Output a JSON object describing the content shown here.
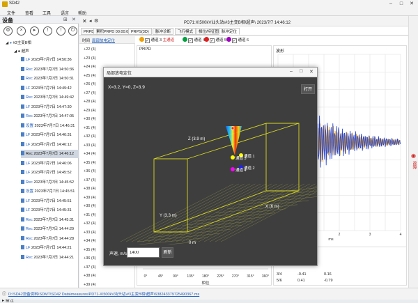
{
  "app": {
    "title": "SD42"
  },
  "menu": [
    "文件",
    "查看",
    "工具",
    "语言",
    "帮助"
  ],
  "left_panel": {
    "title": "设备",
    "tree_root": "#3主变B相",
    "tree_group": "超声",
    "records": [
      {
        "type": "LF",
        "date": "2023年7月7日 14:50:36"
      },
      {
        "type": "Rec",
        "date": "2023年7月7日 14:50:36"
      },
      {
        "type": "Rec",
        "date": "2023年7月7日 14:50:31"
      },
      {
        "type": "LF",
        "date": "2023年7月7日 14:49:42"
      },
      {
        "type": "Rec",
        "date": "2023年7月7日 14:49:42"
      },
      {
        "type": "LF",
        "date": "2023年7月7日 14:47:30"
      },
      {
        "type": "Rec",
        "date": "2023年7月7日 14:47:05"
      },
      {
        "type": "设置",
        "date": "2023年7月7日 14:46:31"
      },
      {
        "type": "LF",
        "date": "2023年7月7日 14:46:31"
      },
      {
        "type": "LF",
        "date": "2023年7月7日 14:46:12"
      },
      {
        "type": "Rec",
        "date": "2023年7月7日 14:46:12"
      },
      {
        "type": "LF",
        "date": "2023年7月7日 14:46:06"
      },
      {
        "type": "LF",
        "date": "2023年7月7日 14:45:52"
      },
      {
        "type": "Rec",
        "date": "2023年7月7日 14:45:52"
      },
      {
        "type": "设置",
        "date": "2023年7月7日 14:45:51"
      },
      {
        "type": "LF",
        "date": "2023年7月7日 14:45:51"
      },
      {
        "type": "LF",
        "date": "2023年7月7日 14:45:31"
      },
      {
        "type": "Rec",
        "date": "2023年7月7日 14:45:31"
      },
      {
        "type": "Rec",
        "date": "2023年7月7日 14:44:29"
      },
      {
        "type": "Rec",
        "date": "2023年7月7日 14:44:28"
      },
      {
        "type": "LF",
        "date": "2023年7月7日 14:44:21"
      },
      {
        "type": "Rec",
        "date": "2023年7月7日 14:44:21"
      }
    ],
    "selected_index": 10,
    "bottom_label": "备注"
  },
  "file_title": "PD71:X\\500kV汕头站\\#3主变B相\\超声\\ 2023/7/7 14:46:12",
  "tabs": [
    "PRPD",
    "累积PRPD 00:00:04",
    "PRPS(3D)",
    "脉冲诊断",
    "飞行模式",
    "相位/特征图谱",
    "脉冲定位"
  ],
  "active_tab": 6,
  "list": {
    "header": "时间",
    "header_link": "局部放电定位",
    "rows": [
      {
        "n": "+22",
        "v": "(4)"
      },
      {
        "n": "+23",
        "v": "(4)"
      },
      {
        "n": "+24",
        "v": "(4)"
      },
      {
        "n": "+25",
        "v": "(4)"
      },
      {
        "n": "+26",
        "v": "(4)"
      },
      {
        "n": "+27",
        "v": "(4)"
      },
      {
        "n": "+28",
        "v": "(4)"
      },
      {
        "n": "+29",
        "v": "(4)"
      },
      {
        "n": "+30",
        "v": "(4)"
      },
      {
        "n": "+31",
        "v": "(4)"
      },
      {
        "n": "+32",
        "v": "(4)"
      },
      {
        "n": "+33",
        "v": "(4)"
      },
      {
        "n": "+34",
        "v": "(4)"
      },
      {
        "n": "+35",
        "v": "(4)"
      },
      {
        "n": "+36",
        "v": "(4)"
      },
      {
        "n": "+37",
        "v": "(4)"
      },
      {
        "n": "+38",
        "v": "(4)"
      },
      {
        "n": "+39",
        "v": "(4)"
      },
      {
        "n": "+30",
        "v": "(4)"
      },
      {
        "n": "+31",
        "v": "(4)"
      },
      {
        "n": "+32",
        "v": "(4)"
      },
      {
        "n": "+33",
        "v": "(4)"
      },
      {
        "n": "+34",
        "v": "(4)"
      },
      {
        "n": "+35",
        "v": "(4)"
      },
      {
        "n": "+36",
        "v": "(4)"
      },
      {
        "n": "+37",
        "v": "(4)"
      },
      {
        "n": "+38",
        "v": "(4)"
      },
      {
        "n": "+39",
        "v": "(4)"
      }
    ]
  },
  "channel_bar": [
    {
      "label": "通道 3",
      "color": "#f0a000",
      "extra": "主通道"
    },
    {
      "label": "通道 4",
      "color": "#00a040"
    },
    {
      "label": "通道 5",
      "color": "#e02020"
    },
    {
      "label": "通道 6",
      "color": "#a000c0"
    }
  ],
  "prpd": {
    "title": "PRPD",
    "xlabel": "相位",
    "xticks": [
      "0°",
      "45°",
      "90°",
      "135°",
      "180°",
      "225°",
      "270°",
      "315°",
      "360°"
    ]
  },
  "waveform": {
    "title": "波形",
    "xlabel": "ms",
    "xticks": [
      "0",
      "1",
      "2",
      "3",
      "4"
    ]
  },
  "table": {
    "rows": [
      {
        "idx": "3/4",
        "a": "-0.41",
        "b": "0.16"
      },
      {
        "idx": "5/6",
        "a": "0.41",
        "b": "-0.79"
      }
    ]
  },
  "right_strip_label": "故障",
  "status_path": "D:\\SD42设备资料\\SDMT\\SD42 Data\\measures\\PD71-X\\500kV汕头站\\#3主变B相\\超声\\638243379725490367.ms",
  "popup": {
    "title": "局部放电定位",
    "coords": "X=3.2, Y=0, Z=3.9",
    "open_label": "打开",
    "axis_x": "X (6 m)",
    "axis_y": "Y (3.3 m)",
    "axis_z": "Z (3.9 m)",
    "origin": "0 m",
    "channels": [
      {
        "label": "通道 1",
        "color": "#ffff00"
      },
      {
        "label": "通道 2",
        "color": "#2020ff"
      },
      {
        "label": "通道 3",
        "color": "#ffff00"
      },
      {
        "label": "通道 4",
        "color": "#ff00ff"
      }
    ],
    "speed_label": "声速, m/s",
    "speed_value": "1400",
    "refresh_label": "刷新"
  }
}
